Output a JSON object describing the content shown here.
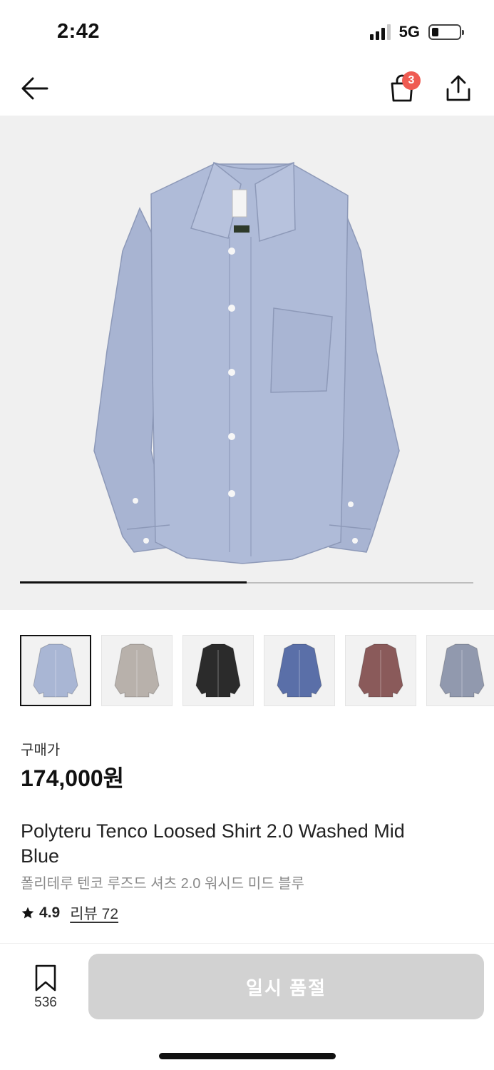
{
  "status_bar": {
    "time": "2:42",
    "network": "5G",
    "signal_icon": "signal-bars-icon",
    "battery_icon": "battery-icon"
  },
  "nav": {
    "back_icon": "arrow-left-icon",
    "cart_icon": "shopping-bag-icon",
    "cart_count": "3",
    "share_icon": "share-upload-icon"
  },
  "gallery": {
    "progress": 0.5,
    "thumbnails": [
      {
        "color": "light-blue",
        "hex": "#a9b6d4",
        "selected": true
      },
      {
        "color": "grey-beige",
        "hex": "#b8b1ab",
        "selected": false
      },
      {
        "color": "black",
        "hex": "#2b2b2b",
        "selected": false
      },
      {
        "color": "navy-blue",
        "hex": "#5a6fa8",
        "selected": false
      },
      {
        "color": "burgundy",
        "hex": "#8a5a5a",
        "selected": false
      },
      {
        "color": "slate-blue",
        "hex": "#9199ae",
        "selected": false
      }
    ]
  },
  "product": {
    "price_label": "구매가",
    "price": "174,000원",
    "name_en": "Polyteru Tenco Loosed Shirt 2.0 Washed Mid Blue",
    "name_ko": "폴리테루 텐코 루즈드 셔츠 2.0 워시드 미드 블루",
    "rating": "4.9",
    "reviews_text": "리뷰 72"
  },
  "bottom_bar": {
    "bookmark_icon": "bookmark-icon",
    "bookmark_count": "536",
    "action_label": "일시 품절"
  },
  "colors": {
    "badge": "#ef5b52",
    "disabled_button": "#d2d2d2"
  }
}
